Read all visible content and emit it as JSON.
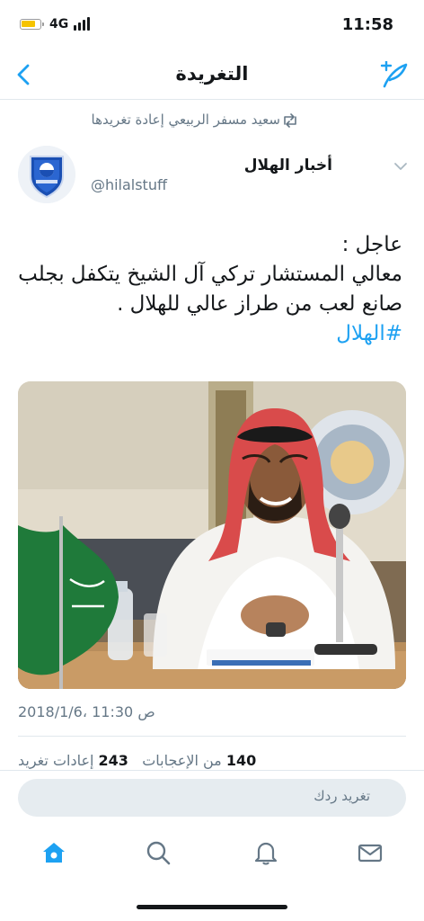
{
  "status_bar": {
    "network": "4G",
    "time": "11:58"
  },
  "nav": {
    "title": "التغريدة"
  },
  "retweet": {
    "text": "سعيد مسفر الربيعي إعادة تغريدها"
  },
  "author": {
    "name": "أخبار الهلال",
    "handle": "@hilalstuff"
  },
  "tweet": {
    "line1": "عاجل :",
    "line2": "معالي المستشار تركي آل الشيخ يتكفل بجلب",
    "line3": "صانع لعب من طراز عالي للهلال .",
    "hashtag": "#الهلال"
  },
  "meta": {
    "timestamp": "2018/1/6، 11:30 ص",
    "likes_count": "140",
    "likes_label": "من الإعجابات",
    "retweets_count": "243",
    "retweets_label": "إعادات تغريد"
  },
  "reply": {
    "placeholder": "تغريد ردك"
  },
  "colors": {
    "accent": "#1da1f2",
    "text": "#14171a",
    "muted": "#657786",
    "divider": "#e1e8ed"
  }
}
